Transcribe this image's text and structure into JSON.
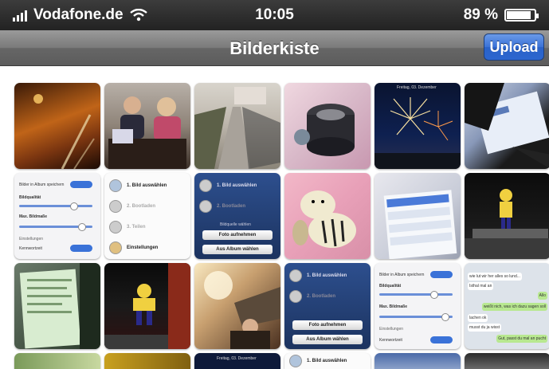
{
  "status_bar": {
    "carrier": "Vodafone.de",
    "time": "10:05",
    "battery": "89 %",
    "battery_level": 0.89,
    "icons": [
      "signal-bars-icon",
      "wifi-icon",
      "battery-icon"
    ]
  },
  "nav_bar": {
    "title": "Bilderkiste",
    "upload_label": "Upload",
    "upload_color": "#2f6bd4"
  },
  "thumbnails": {
    "t1": "",
    "t5_caption": "Freitag, 03. Dezember",
    "t7": {
      "row1": "Bilder in Album speichern",
      "row2": "Bildqualität",
      "row3": "Max. Bildmaße",
      "section": "Einstellungen",
      "row4": "Kennwortzeit"
    },
    "t8": {
      "item1": "1. Bild auswählen",
      "item2": "2. Bootladen",
      "item3": "3. Teilen",
      "item4": "Einstellungen"
    },
    "t9": {
      "item1": "1. Bild auswählen",
      "item2": "2. Bootladen",
      "sheet_title": "Bildquelle wählen",
      "btn1": "Foto aufnehmen",
      "btn2": "Aus Album wählen"
    },
    "t15": {
      "item1": "1. Bild auswählen",
      "item2": "2. Bootladen",
      "btn1": "Foto aufnehmen",
      "btn2": "Aus Album wählen"
    },
    "t16": {
      "row1": "Bilder in Album speichern",
      "row2": "Bildqualität",
      "row3": "Max. Bildmaße",
      "section": "Einstellungen",
      "row4": "Kennwortzeit"
    },
    "t17": {
      "msg1": "wie lut wir her alles so lund...",
      "msg2": "Isthal mal an",
      "msg3": "Allo",
      "msg4": "weißt nich, was ich dazu sagen soll",
      "msg5": "lachen ok",
      "msg6": "musst du ja wisst",
      "msg7": "Gut, passt du mal an pucht"
    },
    "t22_caption": "Freitag, 03. Dezember",
    "t23_item": "1. Bild auswählen"
  }
}
